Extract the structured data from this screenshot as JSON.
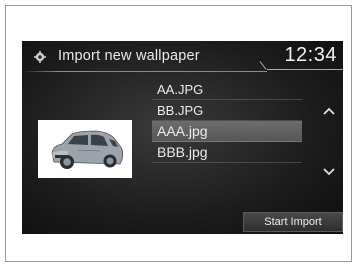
{
  "header": {
    "title": "Import new wallpaper",
    "clock": "12:34",
    "icon": "gear-icon"
  },
  "files": [
    {
      "name": "AA.JPG",
      "selected": false
    },
    {
      "name": "BB.JPG",
      "selected": false
    },
    {
      "name": "AAA.jpg",
      "selected": true
    },
    {
      "name": "BBB.jpg",
      "selected": false
    }
  ],
  "preview": {
    "icon": "car-thumbnail"
  },
  "scroll": {
    "up_icon": "chevron-up-icon",
    "down_icon": "chevron-down-icon"
  },
  "actions": {
    "start_import": "Start Import"
  }
}
